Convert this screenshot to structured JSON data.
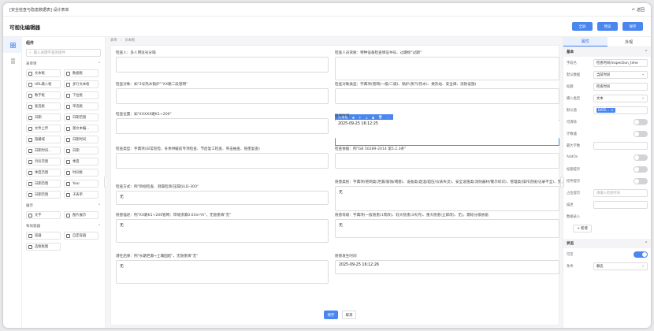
{
  "topbar": {
    "breadcrumb": "[安全检查与隐患数据表] 设计表单",
    "return_label": "返回"
  },
  "header": {
    "title": "可视化编辑器",
    "buttons": [
      "全屏",
      "预览",
      "保存"
    ]
  },
  "left": {
    "title": "组件",
    "search_placeholder": "输入关键字查询组件",
    "groups": [
      {
        "name": "表单项",
        "items": [
          "文本框",
          "数据框",
          "URL输入框",
          "多行文本框",
          "数字框",
          "下拉框",
          "复选框",
          "单选框",
          "日期",
          "日期范围",
          "文件上传",
          "富文本编...",
          "隐藏域",
          "日期时间",
          "日期时间...",
          "日期",
          "月份范围",
          "季度",
          "季度范围",
          "时间框",
          "日期范围",
          "Year",
          "日期范围",
          "子表单"
        ]
      },
      {
        "name": "展示",
        "items": [
          "文字",
          "图片展示"
        ]
      },
      {
        "name": "布局容器",
        "items": [
          "容器",
          "自定容器",
          "选框框图"
        ]
      }
    ]
  },
  "canvas": {
    "crumb": [
      "表单",
      "文本框"
    ],
    "fields": [
      {
        "label": "检查人：多人用逗号分隔",
        "value": ""
      },
      {
        "label": "检查人员资质：特种设备检查填证书号、过期标\"过期\"",
        "value": ""
      },
      {
        "label": "检查对象：如\"3号热水锅炉\"\"XX路二段管网\"",
        "value": ""
      },
      {
        "label": "检查对象类型：字典项(管网(一级/二级)、锅炉(蒸汽/热水)、换热站、安全阀、消防设施)",
        "value": ""
      },
      {
        "label": "检查位置：如\"XXXXX路K1+200\"",
        "value": ""
      },
      {
        "label": "检查时间",
        "value": "2025-09-25 16:12:25"
      },
      {
        "label": "检查类型：字典项(日常巡检、冬季供暖前专项检查、节后复工检查、突击抽查、隐患复查)",
        "value": ""
      },
      {
        "label": "检查依据：例\"GB 50289-2014 第5.2.3条\"",
        "value": ""
      },
      {
        "label": "检查方式：例\"目视检查、测漏检测/压漏仪LD-300\"",
        "value": "无"
      },
      {
        "label": "隐患类别：字典项(管网类(泄漏/腐蚀/堵塞)、设备类(超温/超压/仪表失灵)、安全设施类(消防器材/警示标识)、管理类(操作违规/记录不全)、无)",
        "value": "无"
      },
      {
        "label": "隐患描述：例\"XX路K1+200管网：焊缝渗漏0.03m³/h\"，无隐患填\"无\"",
        "value": "无"
      },
      {
        "label": "隐患等级：字典项(一般隐患(1周改)、较大隐患(3天内)、重大隐患(立即改)、无)，需标分级依据",
        "value": "无"
      },
      {
        "label": "潜在后果：例\"长期泄漏→土壤固结\"，无隐患填\"无\"",
        "value": "无"
      },
      {
        "label": "隐患发生时间",
        "value": "2025-09-25 16:12:26"
      }
    ],
    "selected_label": "文本框",
    "footer": [
      "保存",
      "取消"
    ]
  },
  "right": {
    "tabs": [
      "属性",
      "外观"
    ],
    "basic_title": "基本",
    "props": [
      {
        "label": "字段名",
        "value": "检查时间/inspection_time",
        "type": "input"
      },
      {
        "label": "默认数据",
        "value": "当前时间",
        "type": "select"
      },
      {
        "label": "标题",
        "value": "检查时间",
        "type": "input"
      },
      {
        "label": "输入类型",
        "value": "文本",
        "type": "select"
      },
      {
        "label": "默认值",
        "value": "DATE...",
        "type": "tag"
      },
      {
        "label": "可清除",
        "type": "toggle",
        "on": false
      },
      {
        "label": "计数器",
        "type": "toggle",
        "on": false
      },
      {
        "label": "最大字数",
        "value": "",
        "type": "input"
      },
      {
        "label": "AddOn",
        "type": "toggle",
        "on": false
      },
      {
        "label": "标题提示",
        "type": "toggle",
        "on": false
      },
      {
        "label": "控件提示",
        "type": "toggle",
        "on": false
      },
      {
        "label": "占位提示",
        "value": "请输入检查时间",
        "type": "input"
      },
      {
        "label": "描述",
        "value": "",
        "type": "input"
      }
    ],
    "data_input_label": "数据录入",
    "add_label": "+ 新增",
    "state_title": "状态",
    "visible_label": "可见",
    "condition_label": "条件",
    "condition_value": "静态"
  }
}
